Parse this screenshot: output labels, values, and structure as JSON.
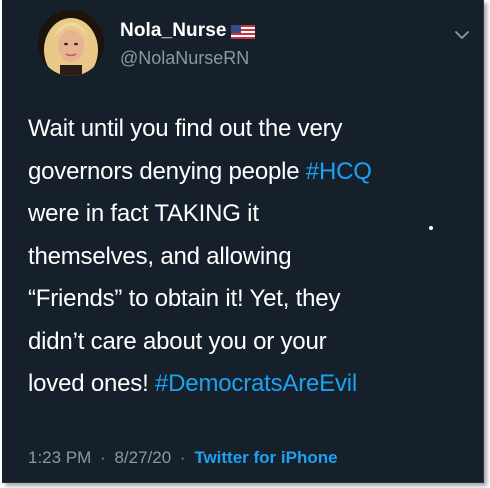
{
  "tweet": {
    "author": {
      "display_name": "Nola_Nurse",
      "handle": "@NolaNurseRN",
      "flag_icon": "us-flag-icon",
      "avatar_icon": "profile-avatar"
    },
    "menu_icon": "chevron-down-icon",
    "lines": [
      [
        {
          "text": "Wait until you find out the very",
          "hashtag": false
        }
      ],
      [
        {
          "text": "governors denying people ",
          "hashtag": false
        },
        {
          "text": "#HCQ",
          "hashtag": true
        }
      ],
      [
        {
          "text": "were in fact TAKING it",
          "hashtag": false
        }
      ],
      [
        {
          "text": "themselves, and allowing",
          "hashtag": false
        }
      ],
      [
        {
          "text": "“Friends” to obtain it! Yet, they",
          "hashtag": false
        }
      ],
      [
        {
          "text": "didn’t care about you or your",
          "hashtag": false
        }
      ],
      [
        {
          "text": "loved ones! ",
          "hashtag": false
        },
        {
          "text": "#DemocratsAreEvil",
          "hashtag": true
        }
      ]
    ],
    "meta": {
      "time": "1:23 PM",
      "separator": "·",
      "date": "8/27/20",
      "source": "Twitter for iPhone"
    }
  },
  "colors": {
    "background": "#15202b",
    "text": "#ffffff",
    "secondary_text": "#8899a6",
    "link": "#1da1f2"
  }
}
